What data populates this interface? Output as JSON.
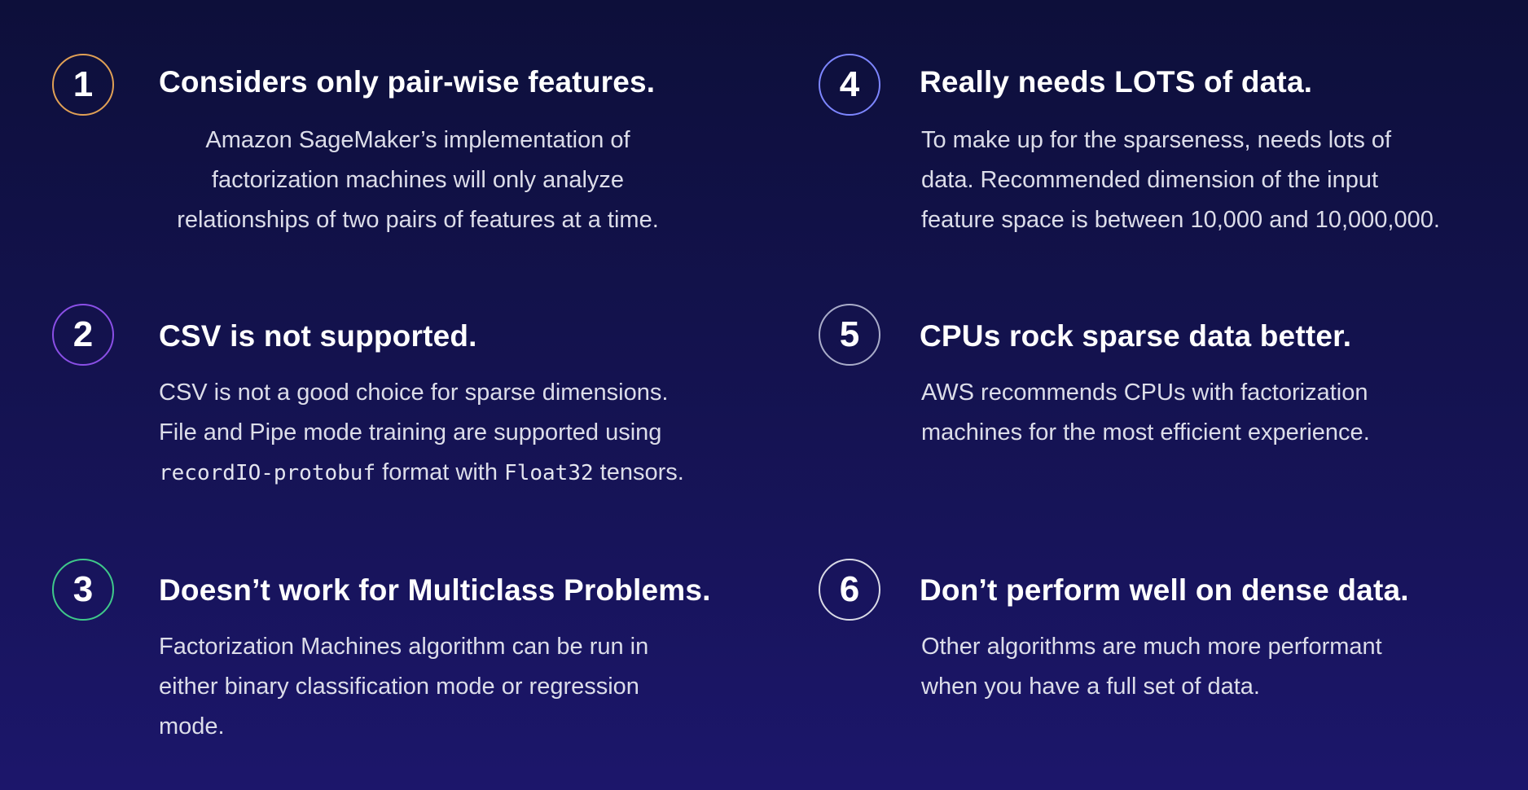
{
  "colors": {
    "badge_1": "#e0a055",
    "badge_2": "#8a4fe6",
    "badge_3": "#3fc98a",
    "badge_4": "#7d86ff",
    "badge_5": "#a9acc9",
    "badge_6": "#d9dae6"
  },
  "items": [
    {
      "number": "1",
      "heading": "Considers only pair-wise features.",
      "body": "Amazon SageMaker’s implementation of factorization machines will only analyze relationships of two pairs of features at a time."
    },
    {
      "number": "2",
      "heading": "CSV is not supported.",
      "body_part1": "CSV is not a good choice for sparse dimensions.  File and Pipe mode training are supported using ",
      "body_code1": "recordIO-protobuf",
      "body_part2": " format with ",
      "body_code2": "Float32",
      "body_part3": " tensors."
    },
    {
      "number": "3",
      "heading": "Doesn’t work for Multiclass Problems.",
      "body": "Factorization Machines algorithm can be run in either binary classification mode or regression mode."
    },
    {
      "number": "4",
      "heading": "Really needs LOTS of data.",
      "body": "To make up for the sparseness, needs lots of data. Recommended dimension of the input feature space is between 10,000 and 10,000,000."
    },
    {
      "number": "5",
      "heading": "CPUs rock sparse data better.",
      "body": "AWS recommends CPUs with factorization machines for the most efficient experience."
    },
    {
      "number": "6",
      "heading": "Don’t perform well on dense data.",
      "body": "Other algorithms are much more performant when you have a full set of data."
    }
  ]
}
